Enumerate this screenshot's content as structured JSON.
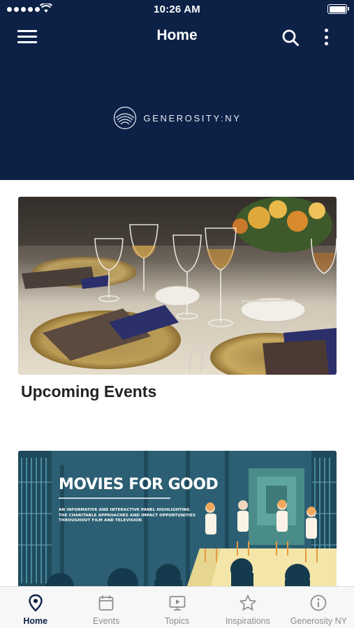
{
  "status_bar": {
    "time": "10:26 AM",
    "signal_bars": 5,
    "battery_level": 1.0
  },
  "nav": {
    "title": "Home",
    "menu_icon": "hamburger-menu-icon",
    "search_icon": "search-icon",
    "more_icon": "more-vertical-icon"
  },
  "header": {
    "logo_text": "GENEROSITY:NY"
  },
  "cards": [
    {
      "title": "Upcoming Events"
    },
    {
      "headline": "MOVIES FOR GOOD",
      "subtext": "AN INFORMATIVE AND INTERACTIVE PANEL HIGHLIGHTING THE CHARITABLE APPROACHES AND IMPACT OPPORTUNITIES THROUGHOUT FILM AND TELEVISION"
    }
  ],
  "tabs": [
    {
      "label": "Home",
      "icon": "location-pin-icon",
      "active": true
    },
    {
      "label": "Events",
      "icon": "calendar-icon",
      "active": false
    },
    {
      "label": "Topics",
      "icon": "video-screen-icon",
      "active": false
    },
    {
      "label": "Inspirations",
      "icon": "star-icon",
      "active": false
    },
    {
      "label": "Generosity NY",
      "icon": "info-icon",
      "active": false
    }
  ],
  "colors": {
    "header_bg": "#0d2147",
    "tab_active": "#0d2147",
    "tab_inactive": "#8e8e8e"
  }
}
